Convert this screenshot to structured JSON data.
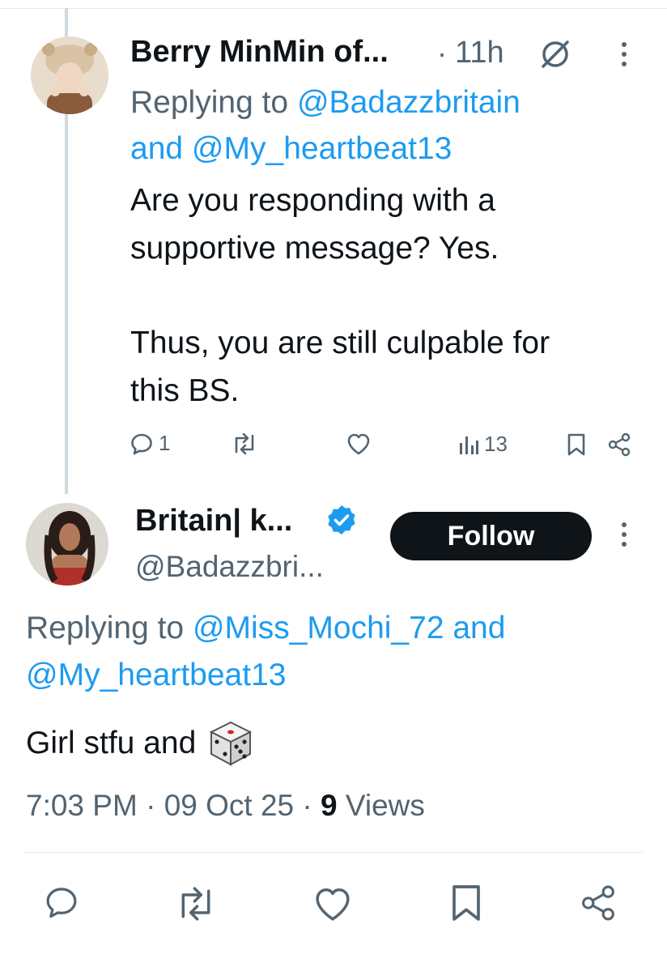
{
  "reply_tweet": {
    "author_name": "Berry MinMin of...",
    "separator": "·",
    "time": "11h",
    "replying_prefix": "Replying to",
    "replying_handle_1": "@Badazzbritain",
    "replying_and": "and",
    "replying_handle_2": "@My_heartbeat13",
    "text_line_1": "Are you responding with a",
    "text_line_2": "supportive message? Yes.",
    "text_line_3": "Thus, you are still culpable for",
    "text_line_4": "this BS.",
    "reply_count": "1",
    "view_count": "13"
  },
  "main_tweet": {
    "author_name": "Britain| k...",
    "handle": "@Badazzbri...",
    "follow_label": "Follow",
    "replying_prefix": "Replying to",
    "replying_handle_1": "@Miss_Mochi_72",
    "replying_and": "and",
    "replying_handle_2": "@My_heartbeat13",
    "text": "Girl stfu and",
    "emoji_icon": "game-die",
    "timestamp": "7:03 PM",
    "date": "09 Oct 25",
    "views_count": "9",
    "views_label": "Views"
  },
  "icons": [
    "no-sync-icon",
    "more-icon",
    "reply-icon",
    "retweet-icon",
    "like-icon",
    "views-icon",
    "bookmark-icon",
    "share-icon",
    "verified-icon"
  ],
  "colors": {
    "link": "#1d9bf0",
    "muted": "#536471",
    "text": "#0f1419",
    "follow_bg": "#0f1419",
    "verified": "#1d9bf0"
  }
}
